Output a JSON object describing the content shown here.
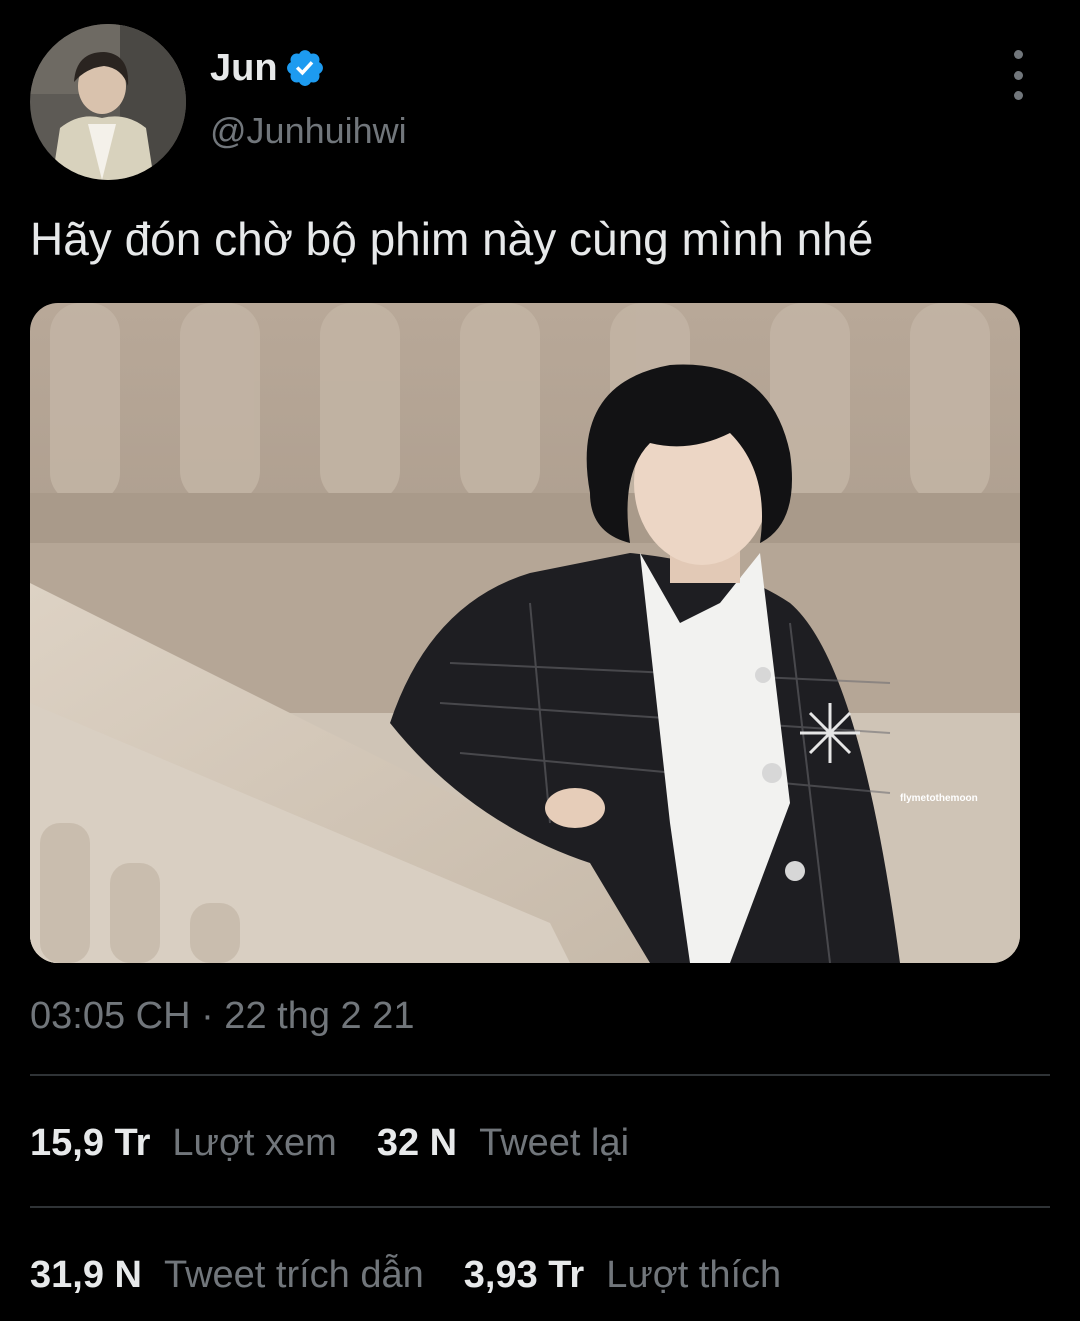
{
  "author": {
    "name": "Jun",
    "handle": "@Junhuihwi",
    "verified_icon": "verified-badge-icon",
    "avatar_icon": "avatar-photo"
  },
  "tweet": {
    "text": "Hãy đón chờ bộ phim này cùng mình nhé",
    "media_watermark": "flymetothemoon",
    "timestamp": "03:05 CH · 22 thg 2 21"
  },
  "stats": {
    "views": {
      "count": "15,9 Tr",
      "label": "Lượt xem"
    },
    "retweets": {
      "count": "32 N",
      "label": "Tweet lại"
    },
    "quotes": {
      "count": "31,9 N",
      "label": "Tweet trích dẫn"
    },
    "likes": {
      "count": "3,93 Tr",
      "label": "Lượt thích"
    }
  },
  "colors": {
    "background": "#000000",
    "text_primary": "#e7e9ea",
    "text_secondary": "#71767b",
    "divider": "#2f3336",
    "verified": "#1d9bf0"
  }
}
